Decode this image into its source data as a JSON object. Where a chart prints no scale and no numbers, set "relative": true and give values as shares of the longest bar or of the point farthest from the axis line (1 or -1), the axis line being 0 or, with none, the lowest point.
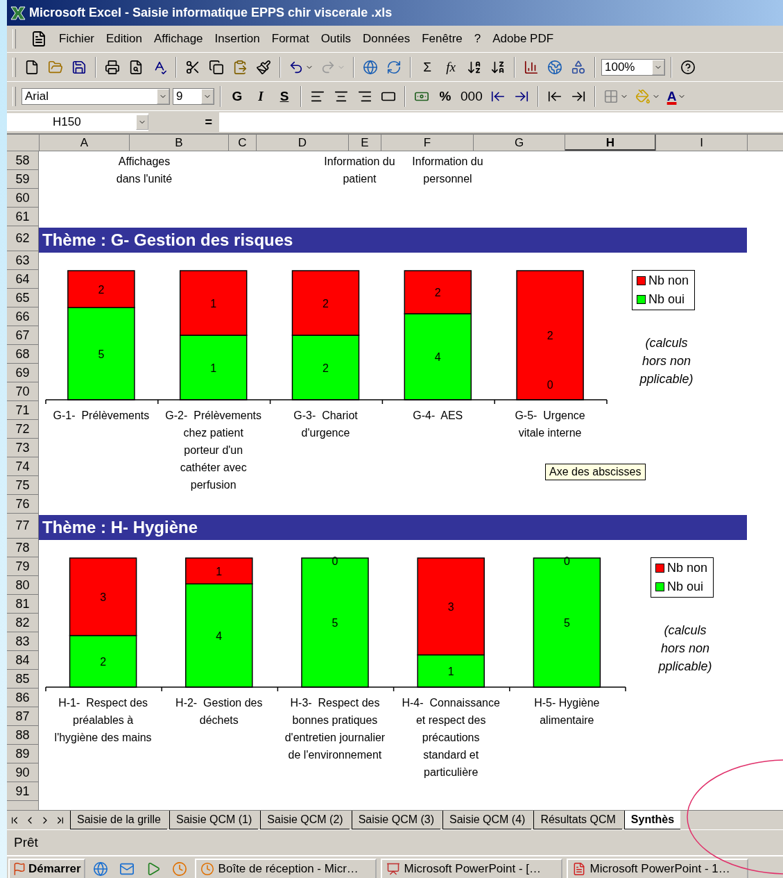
{
  "window": {
    "title": "Microsoft Excel - Saisie informatique EPPS chir viscerale .xls"
  },
  "menu": [
    "Fichier",
    "Edition",
    "Affichage",
    "Insertion",
    "Format",
    "Outils",
    "Données",
    "Fenêtre",
    "?",
    "Adobe PDF"
  ],
  "standard_toolbar": {
    "sum": "Σ",
    "function": "fx",
    "zoom": "100%"
  },
  "formatting_toolbar": {
    "font": "Arial",
    "size": "9",
    "bold": "G",
    "italic": "I",
    "underline": "S",
    "percent": "%",
    "thousands": "000",
    "font_color": "A"
  },
  "formula_bar": {
    "name_box": "H150",
    "equals": "="
  },
  "columns": [
    {
      "label": "A",
      "selected": false
    },
    {
      "label": "B",
      "selected": false
    },
    {
      "label": "C",
      "selected": false
    },
    {
      "label": "D",
      "selected": false
    },
    {
      "label": "E",
      "selected": false
    },
    {
      "label": "F",
      "selected": false
    },
    {
      "label": "G",
      "selected": false
    },
    {
      "label": "H",
      "selected": true
    },
    {
      "label": "I",
      "selected": false
    }
  ],
  "rows": [
    "58",
    "59",
    "60",
    "61",
    "62",
    "63",
    "64",
    "65",
    "66",
    "67",
    "68",
    "69",
    "70",
    "71",
    "72",
    "73",
    "74",
    "75",
    "76",
    "77",
    "78",
    "79",
    "80",
    "81",
    "82",
    "83",
    "84",
    "85",
    "86",
    "87",
    "88",
    "89",
    "90",
    "91"
  ],
  "header_cells": [
    "Affichages\ndans l'unité",
    "Information du\npatient",
    "Information du\npersonnel"
  ],
  "themes": [
    {
      "title": "Thème : G- Gestion des risques",
      "note": "(calculs\nhors non\npplicable)",
      "tooltip": "Axe des abscisses",
      "chart_data": {
        "type": "bar",
        "stacked": true,
        "relative": true,
        "value_labels": [
          [
            "2",
            "1",
            "2",
            "2",
            "2"
          ],
          [
            "5",
            "1",
            "2",
            "4",
            "0"
          ]
        ],
        "categories": [
          "G-1-  Prélèvements",
          "G-2-  Prélèvements\nchez patient\nporteur d'un\ncathéter avec\nperfusion",
          "G-3-  Chariot\nd'urgence",
          "G-4-  AES",
          "G-5-  Urgence\nvitale interne"
        ],
        "series": [
          {
            "name": "Nb non",
            "color": "#ff0000",
            "values": [
              0.2857,
              0.5,
              0.5,
              0.3333,
              1
            ]
          },
          {
            "name": "Nb oui",
            "color": "#00ff00",
            "values": [
              0.7143,
              0.5,
              0.5,
              0.6667,
              0
            ]
          }
        ]
      }
    },
    {
      "title": "Thème : H- Hygiène",
      "note": "(calculs\nhors non\npplicable)",
      "chart_data": {
        "type": "bar",
        "stacked": true,
        "relative": true,
        "value_labels": [
          [
            "3",
            "1",
            "0",
            "3",
            "0"
          ],
          [
            "2",
            "4",
            "5",
            "1",
            "5"
          ]
        ],
        "categories": [
          "H-1-  Respect des\npréalables à\nl'hygiène des mains",
          "H-2-  Gestion des\ndéchets",
          "H-3-  Respect des\nbonnes pratiques\nd'entretien journalier\nde l'environnement",
          "H-4-  Connaissance\net respect des\nprécautions\nstandard et\nparticulière",
          "H-5- Hygiène\nalimentaire"
        ],
        "series": [
          {
            "name": "Nb non",
            "color": "#ff0000",
            "values": [
              0.6,
              0.2,
              0,
              0.75,
              0
            ]
          },
          {
            "name": "Nb oui",
            "color": "#00ff00",
            "values": [
              0.4,
              0.8,
              1,
              0.25,
              1
            ]
          }
        ]
      }
    }
  ],
  "sheet_tabs": [
    {
      "label": "Saisie de la grille",
      "selected": false
    },
    {
      "label": "Saisie QCM (1)",
      "selected": false
    },
    {
      "label": "Saisie QCM (2)",
      "selected": false
    },
    {
      "label": "Saisie QCM (3)",
      "selected": false
    },
    {
      "label": "Saisie QCM (4)",
      "selected": false
    },
    {
      "label": "Résultats QCM",
      "selected": false
    },
    {
      "label": "Synthès",
      "selected": true
    }
  ],
  "status_bar": "Prêt",
  "taskbar": {
    "start": "Démarrer",
    "tasks": [
      "Boîte de réception - Micr…",
      "Microsoft PowerPoint - […",
      "Microsoft PowerPoint - 1…"
    ]
  }
}
